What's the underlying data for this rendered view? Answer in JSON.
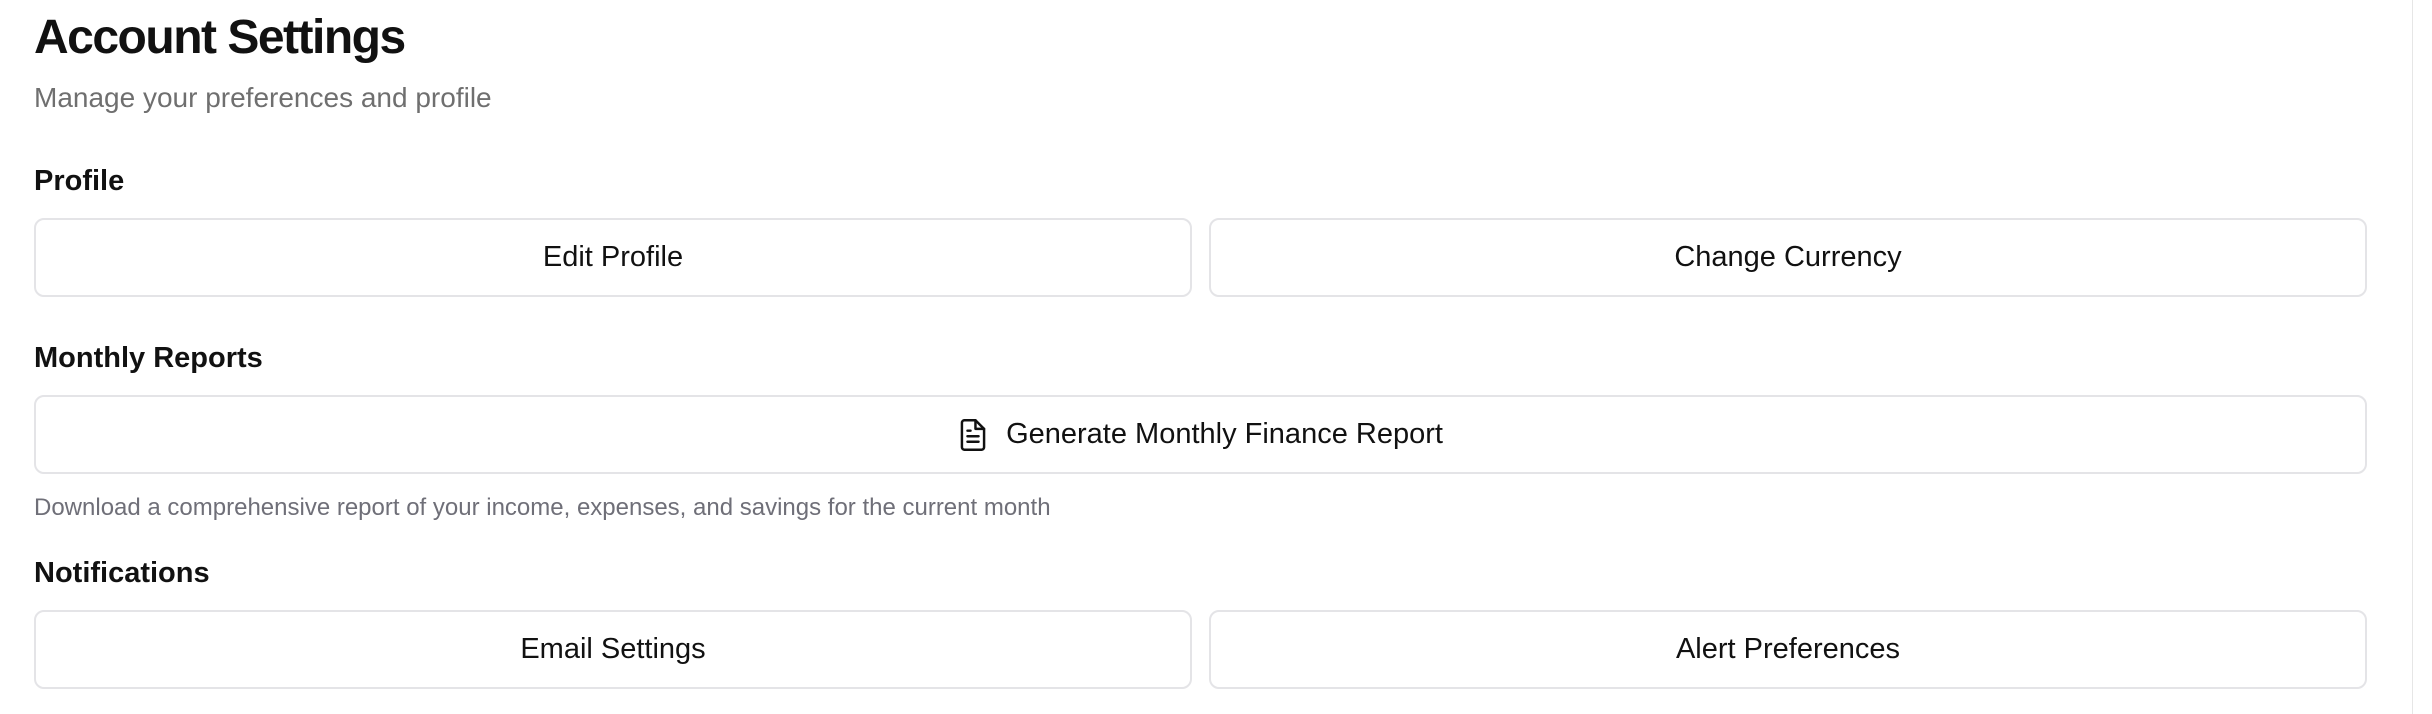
{
  "header": {
    "title": "Account Settings",
    "subtitle": "Manage your preferences and profile"
  },
  "sections": {
    "profile": {
      "title": "Profile",
      "edit_profile_label": "Edit Profile",
      "change_currency_label": "Change Currency"
    },
    "reports": {
      "title": "Monthly Reports",
      "generate_label": "Generate Monthly Finance Report",
      "generate_icon": "file-text-icon",
      "hint": "Download a comprehensive report of your income, expenses, and savings for the current month"
    },
    "notifications": {
      "title": "Notifications",
      "email_settings_label": "Email Settings",
      "alert_preferences_label": "Alert Preferences"
    }
  },
  "colors": {
    "border": "#e4e4e7",
    "muted_text": "#6f6f6f",
    "text": "#111111"
  }
}
